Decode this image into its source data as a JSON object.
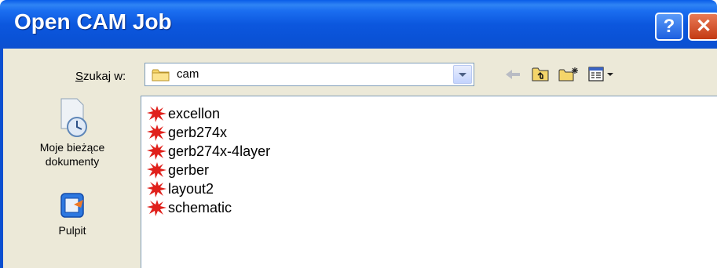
{
  "window": {
    "title": "Open CAM Job",
    "help_glyph": "?",
    "close_glyph": "✕"
  },
  "lookin": {
    "label_underlined": "S",
    "label_rest": "zukaj w:",
    "value": "cam",
    "icon": "folder-icon"
  },
  "toolbar": {
    "icons": [
      "back-arrow-icon",
      "up-folder-icon",
      "new-folder-icon",
      "view-menu-icon"
    ]
  },
  "places": [
    {
      "line1": "Moje bieżące",
      "line2": "dokumenty",
      "icon": "recent-documents-icon"
    },
    {
      "line1": "Pulpit",
      "line2": "",
      "icon": "desktop-icon"
    }
  ],
  "files": [
    {
      "name": "excellon"
    },
    {
      "name": "gerb274x"
    },
    {
      "name": "gerb274x-4layer"
    },
    {
      "name": "gerber"
    },
    {
      "name": "layout2"
    },
    {
      "name": "schematic"
    }
  ],
  "colors": {
    "titlebar": "#0a52d6",
    "dialog_bg": "#ece9d8",
    "file_icon": "#e0201b"
  }
}
